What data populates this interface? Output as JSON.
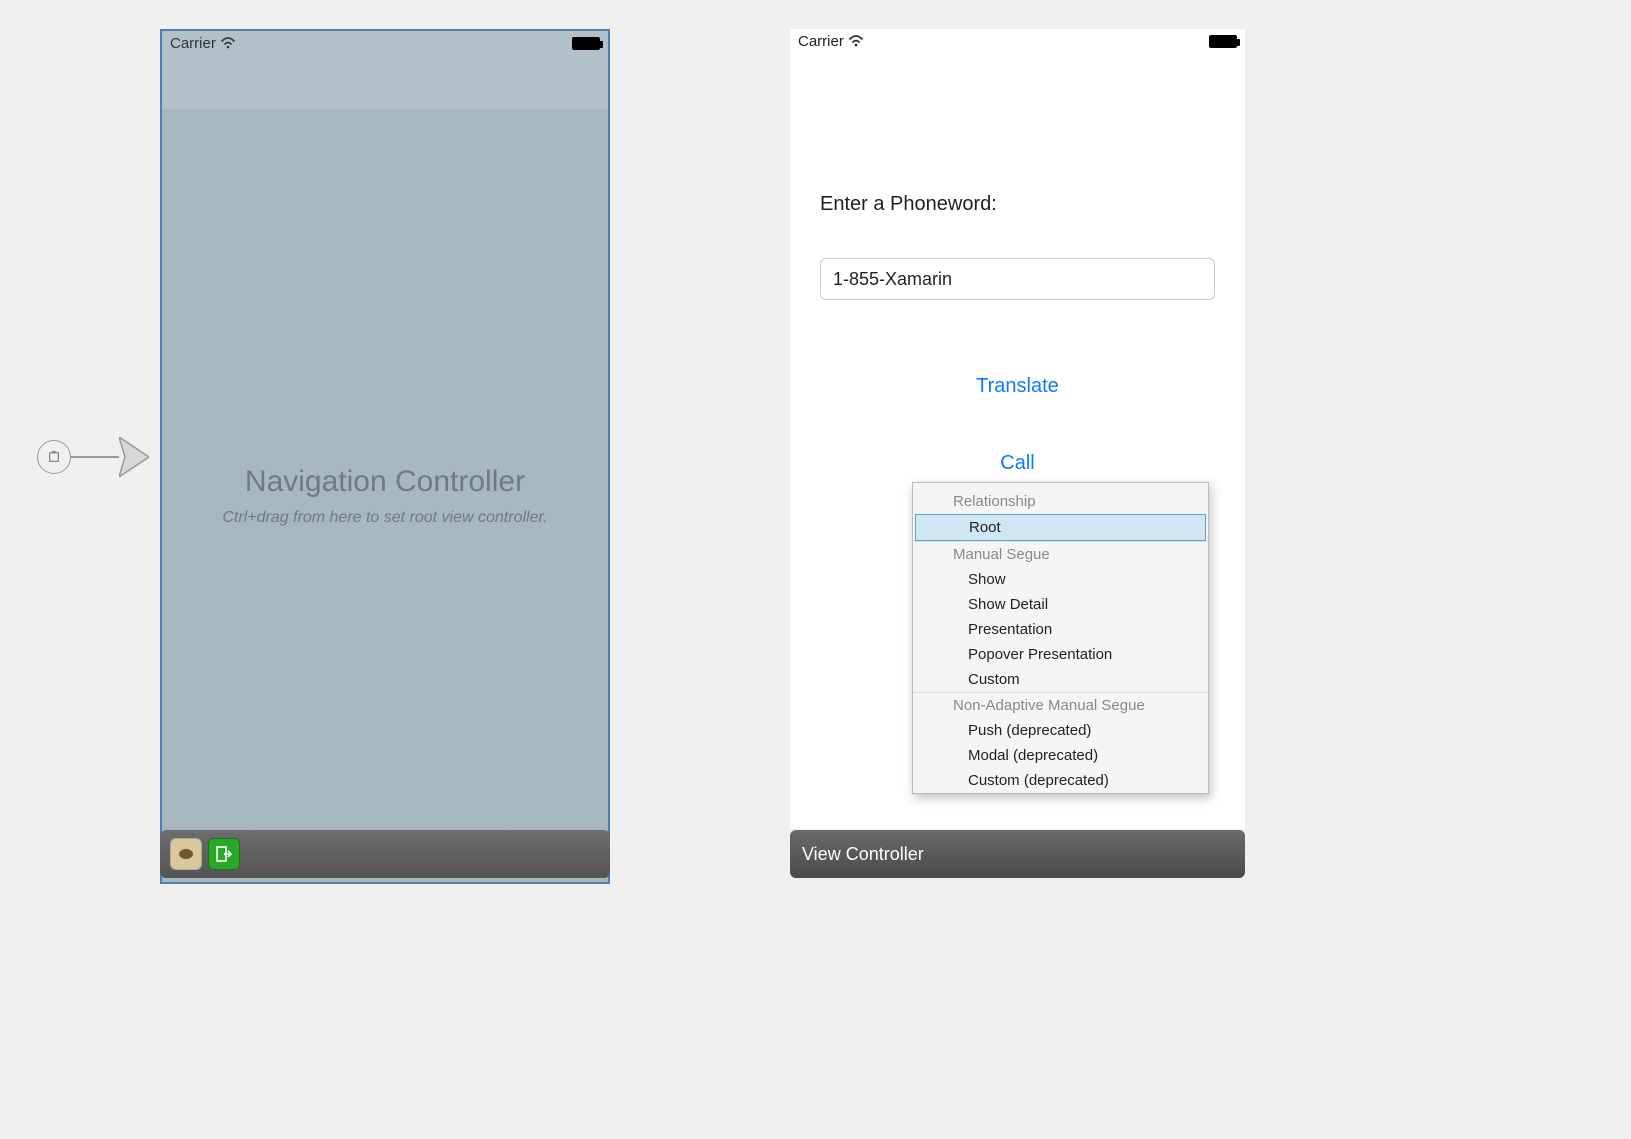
{
  "status": {
    "carrier": "Carrier"
  },
  "navController": {
    "title": "Navigation Controller",
    "subtitle": "Ctrl+drag from here to set root view controller."
  },
  "viewController": {
    "label": "Enter a Phoneword:",
    "inputValue": "1-855-Xamarin",
    "translateLabel": "Translate",
    "callLabel": "Call",
    "footerTitle": "View Controller"
  },
  "seguePopup": {
    "relationshipHeader": "Relationship",
    "rootLabel": "Root",
    "manualHeader": "Manual Segue",
    "showLabel": "Show",
    "showDetailLabel": "Show Detail",
    "presentationLabel": "Presentation",
    "popoverLabel": "Popover Presentation",
    "customLabel": "Custom",
    "nonAdaptiveHeader": "Non-Adaptive Manual Segue",
    "pushLabel": "Push (deprecated)",
    "modalLabel": "Modal (deprecated)",
    "customDeprecatedLabel": "Custom (deprecated)"
  }
}
